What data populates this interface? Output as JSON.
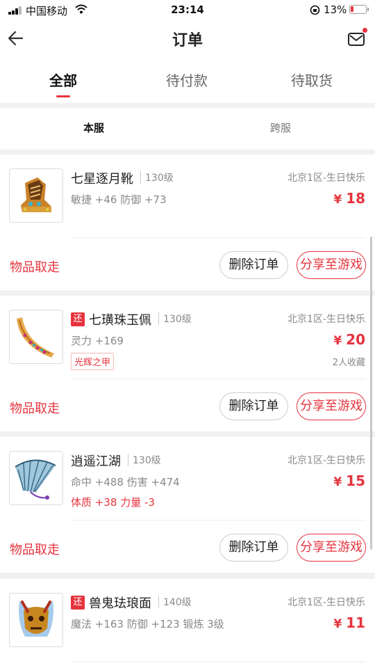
{
  "status_bar": {
    "carrier": "中国移动",
    "time": "23:14",
    "battery": "13%",
    "battery_color": "#e6333d"
  },
  "nav": {
    "title": "订单",
    "back_icon": "arrow-left-icon",
    "mail_icon": "mail-icon"
  },
  "tabs": [
    {
      "label": "全部",
      "active": true
    },
    {
      "label": "待付款",
      "active": false
    },
    {
      "label": "待取货",
      "active": false
    }
  ],
  "subtabs": [
    {
      "label": "本服",
      "active": true
    },
    {
      "label": "跨服",
      "active": false
    }
  ],
  "accent_color": "#e6333d",
  "orders": [
    {
      "name": "七星逐月靴",
      "level": "130级",
      "server": "北京1区-生日快乐",
      "attrs": "敏捷 +46 防御 +73",
      "currency": "¥",
      "price": "18",
      "status": "物品取走",
      "delete_label": "删除订单",
      "share_label": "分享至游戏"
    },
    {
      "badge": "还",
      "name": "七璜珠玉佩",
      "level": "130级",
      "server": "北京1区-生日快乐",
      "attrs": "灵力 +169",
      "tag": "光辉之甲",
      "currency": "¥",
      "price": "20",
      "favorites": "2人收藏",
      "status": "物品取走",
      "delete_label": "删除订单",
      "share_label": "分享至游戏"
    },
    {
      "name": "逍遥江湖",
      "level": "130级",
      "server": "北京1区-生日快乐",
      "attrs": "命中 +488 伤害 +474",
      "extra_attrs": "体质 +38 力量 -3",
      "currency": "¥",
      "price": "15",
      "status": "物品取走",
      "delete_label": "删除订单",
      "share_label": "分享至游戏"
    },
    {
      "badge": "还",
      "name": "兽鬼珐琅面",
      "level": "140级",
      "server": "北京1区-生日快乐",
      "attrs": "魔法 +163 防御 +123 锻炼 3级",
      "currency": "¥",
      "price": "11"
    }
  ]
}
